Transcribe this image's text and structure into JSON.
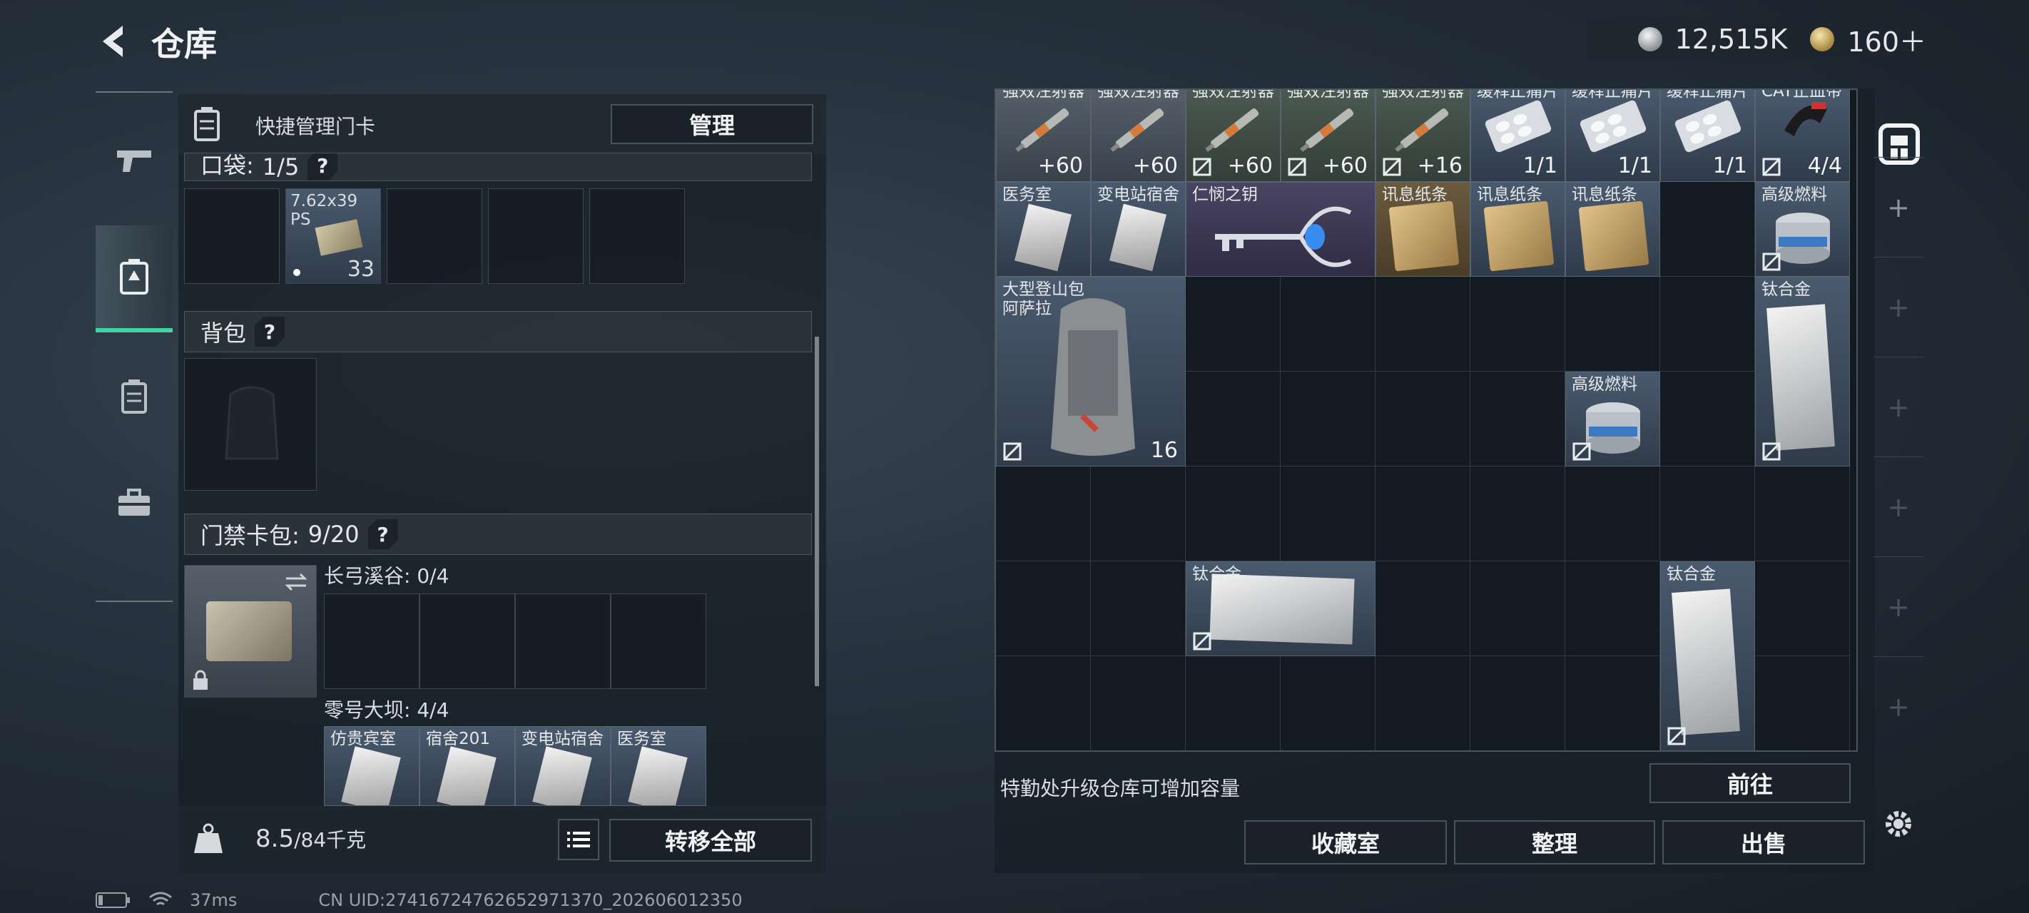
{
  "header": {
    "title": "仓库",
    "currency": [
      {
        "icon": "silver-coin-icon",
        "value": "12,515K"
      },
      {
        "icon": "gold-coin-icon",
        "value": "160＋"
      }
    ]
  },
  "left_nav": [
    {
      "icon": "pistol-icon",
      "active": false
    },
    {
      "icon": "backpack-slot-icon",
      "active": true
    },
    {
      "icon": "keycard-case-icon",
      "active": false
    },
    {
      "icon": "toolbox-icon",
      "active": false
    }
  ],
  "left_panel": {
    "quick_label": "快捷管理门卡",
    "manage_button": "管理",
    "pocket": {
      "label": "口袋:",
      "count": "1/5",
      "help": "?"
    },
    "pocket_item": {
      "name": "7.62x39",
      "sub": "PS",
      "qty": "33"
    },
    "backpack": {
      "label": "背包",
      "help": "?"
    },
    "keycard_pack": {
      "label": "门禁卡包:",
      "count": "9/20",
      "help": "?"
    },
    "map_a": {
      "label": "长弓溪谷: 0/4"
    },
    "map_b": {
      "label": "零号大坝: 4/4"
    },
    "dam_cards": [
      "仿贵宾室",
      "宿舍201",
      "变电站宿舍",
      "医务室"
    ],
    "weight": {
      "value": "8.5",
      "max": "/84千克"
    },
    "transfer_all": "转移全部"
  },
  "right_panel": {
    "items": [
      {
        "name": "强效注射器",
        "qty": "+60"
      },
      {
        "name": "强效注射器",
        "qty": "+60"
      },
      {
        "name": "强效注射器",
        "qty": "+60"
      },
      {
        "name": "强效注射器",
        "qty": "+60"
      },
      {
        "name": "强效注射器",
        "qty": "+16"
      },
      {
        "name": "缓释止痛片",
        "qty": "1/1"
      },
      {
        "name": "缓释止痛片",
        "qty": "1/1"
      },
      {
        "name": "缓释止痛片",
        "qty": "1/1"
      },
      {
        "name": "CAT止血带",
        "qty": "4/4"
      },
      {
        "name": "医务室",
        "qty": ""
      },
      {
        "name": "变电站宿舍",
        "qty": ""
      },
      {
        "name": "仁悯之钥",
        "qty": ""
      },
      {
        "name": "讯息纸条",
        "qty": ""
      },
      {
        "name": "讯息纸条",
        "qty": ""
      },
      {
        "name": "讯息纸条",
        "qty": ""
      },
      {
        "name": "高级燃料",
        "qty": ""
      },
      {
        "name": "大型登山包\n阿萨拉",
        "qty": "16"
      },
      {
        "name": "钛合金",
        "qty": ""
      },
      {
        "name": "高级燃料",
        "qty": ""
      },
      {
        "name": "钛合金",
        "qty": ""
      },
      {
        "name": "钛合金",
        "qty": ""
      }
    ],
    "upgrade_hint": "特勤处升级仓库可增加容量",
    "goto_button": "前往",
    "collection_button": "收藏室",
    "sort_button": "整理",
    "sell_button": "出售"
  },
  "status_bar": {
    "ping": "37ms",
    "uid": "CN UID:2741672476265​2971370_202606012350"
  },
  "colors": {
    "accent": "#3fd4a6",
    "panel": "#161e25"
  }
}
